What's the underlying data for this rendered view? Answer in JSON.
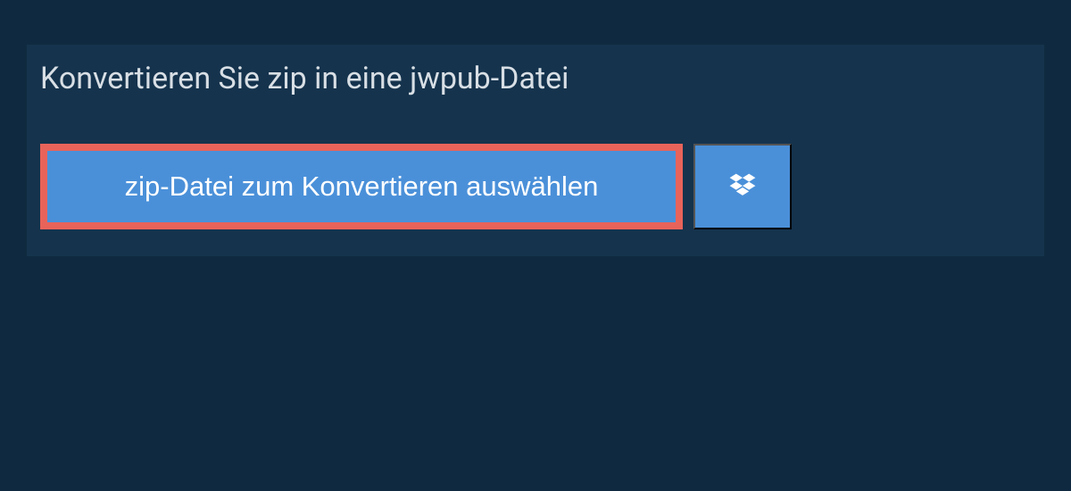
{
  "title": "Konvertieren Sie zip in eine jwpub-Datei",
  "selectButton": {
    "label": "zip-Datei zum Konvertieren auswählen"
  },
  "colors": {
    "background": "#0f2a40",
    "panel": "#15334d",
    "buttonBlue": "#4a90d9",
    "buttonBorder": "#e8635a",
    "text": "#d8dfe5"
  }
}
